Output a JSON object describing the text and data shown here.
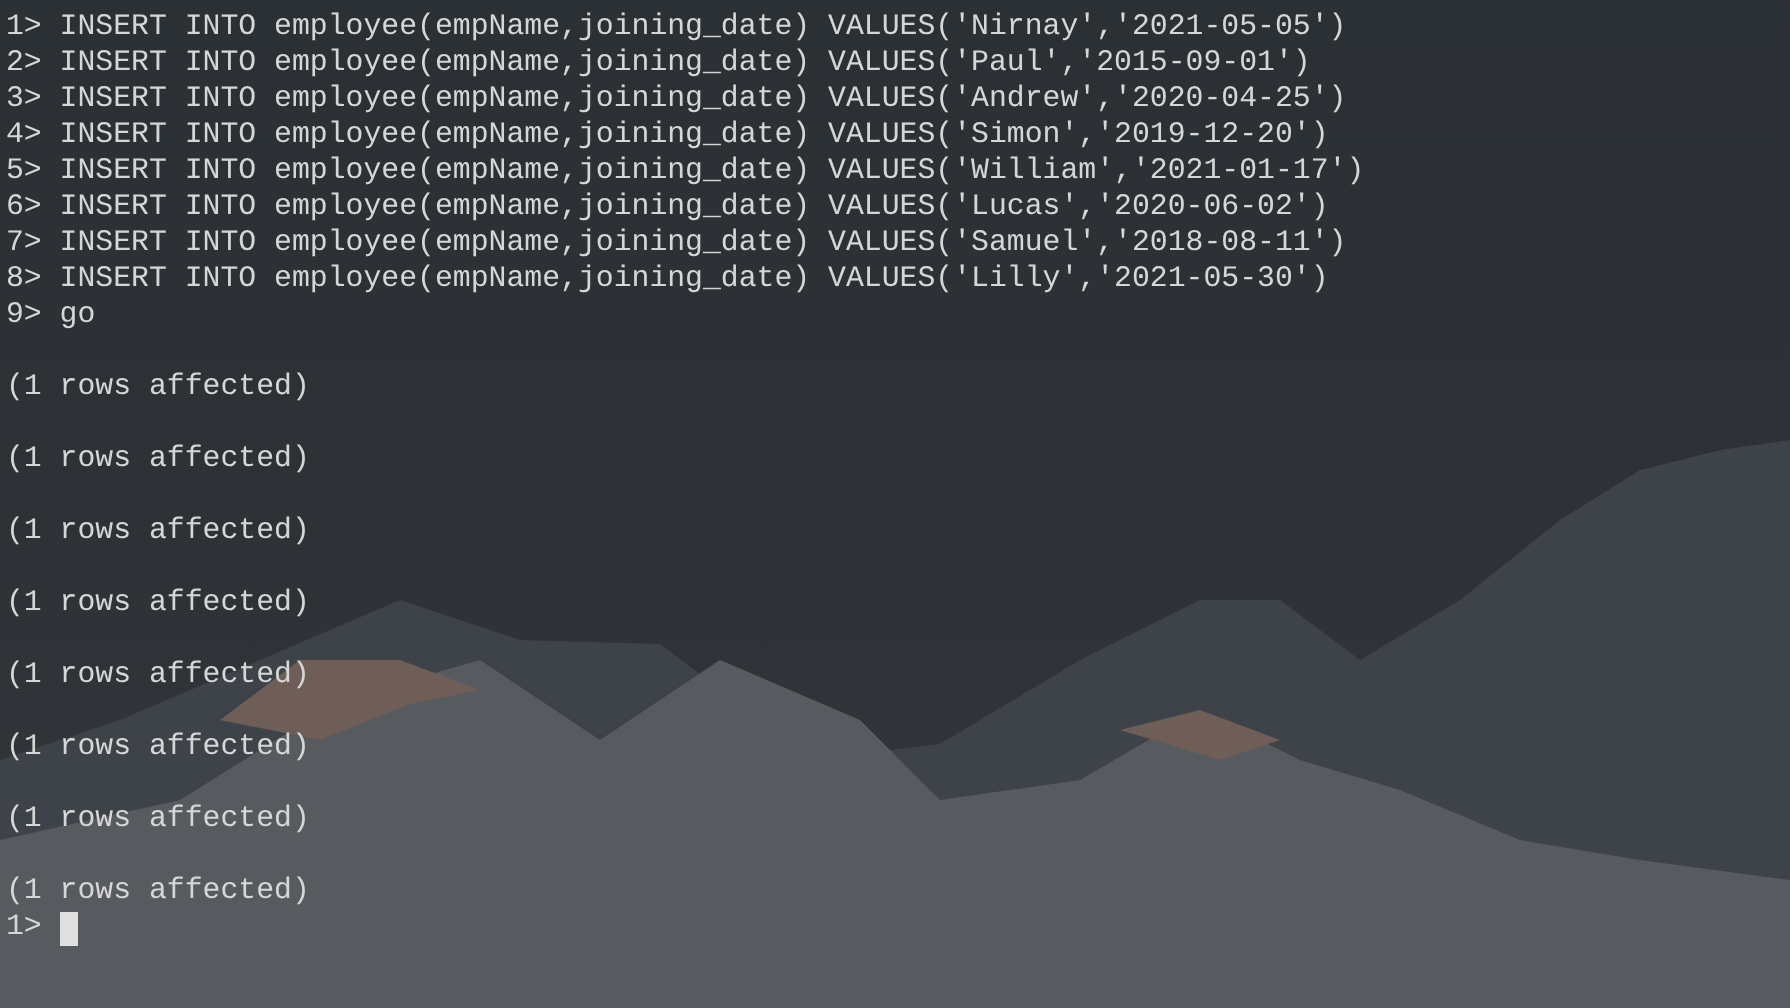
{
  "terminal": {
    "input_lines": [
      "1> INSERT INTO employee(empName,joining_date) VALUES('Nirnay','2021-05-05')",
      "2> INSERT INTO employee(empName,joining_date) VALUES('Paul','2015-09-01')",
      "3> INSERT INTO employee(empName,joining_date) VALUES('Andrew','2020-04-25')",
      "4> INSERT INTO employee(empName,joining_date) VALUES('Simon','2019-12-20')",
      "5> INSERT INTO employee(empName,joining_date) VALUES('William','2021-01-17')",
      "6> INSERT INTO employee(empName,joining_date) VALUES('Lucas','2020-06-02')",
      "7> INSERT INTO employee(empName,joining_date) VALUES('Samuel','2018-08-11')",
      "8> INSERT INTO employee(empName,joining_date) VALUES('Lilly','2021-05-30')",
      "9> go"
    ],
    "results": [
      "(1 rows affected)",
      "(1 rows affected)",
      "(1 rows affected)",
      "(1 rows affected)",
      "(1 rows affected)",
      "(1 rows affected)",
      "(1 rows affected)",
      "(1 rows affected)"
    ],
    "prompt": "1>"
  }
}
